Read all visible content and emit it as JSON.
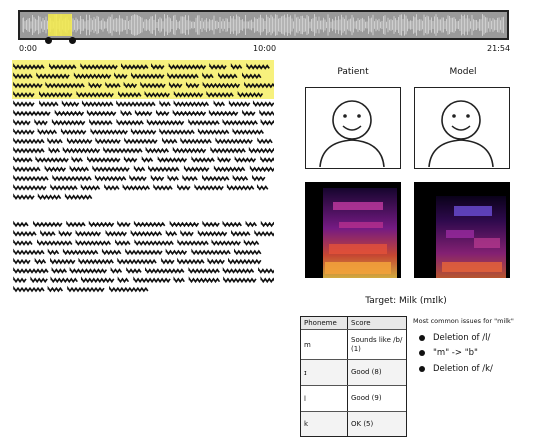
{
  "timeline": {
    "start_time": "0:00",
    "mid_time": "10:00",
    "end_time": "21:54",
    "selection_fraction_start": 0.06,
    "selection_fraction_end": 0.11,
    "selection_color": "#f4eb4a"
  },
  "transcript": {
    "highlight_color": "#f7f17d",
    "paragraph_line_counts": [
      15,
      8
    ]
  },
  "panels": {
    "patient_label": "Patient",
    "model_label": "Model"
  },
  "target": {
    "label": "Target: Milk (mɪlk)"
  },
  "phoneme_table": {
    "headers": [
      "Phoneme",
      "Score"
    ],
    "rows": [
      {
        "phoneme": "m",
        "score": "Sounds like /b/ (1)"
      },
      {
        "phoneme": "ɪ",
        "score": "Good (8)"
      },
      {
        "phoneme": "l",
        "score": "Good (9)"
      },
      {
        "phoneme": "k",
        "score": "OK (5)"
      }
    ]
  },
  "issues": {
    "title": "Most common issues for \"milk\"",
    "items": [
      "Deletion of /l/",
      "\"m\" -> \"b\"",
      "Deletion of /k/"
    ]
  }
}
